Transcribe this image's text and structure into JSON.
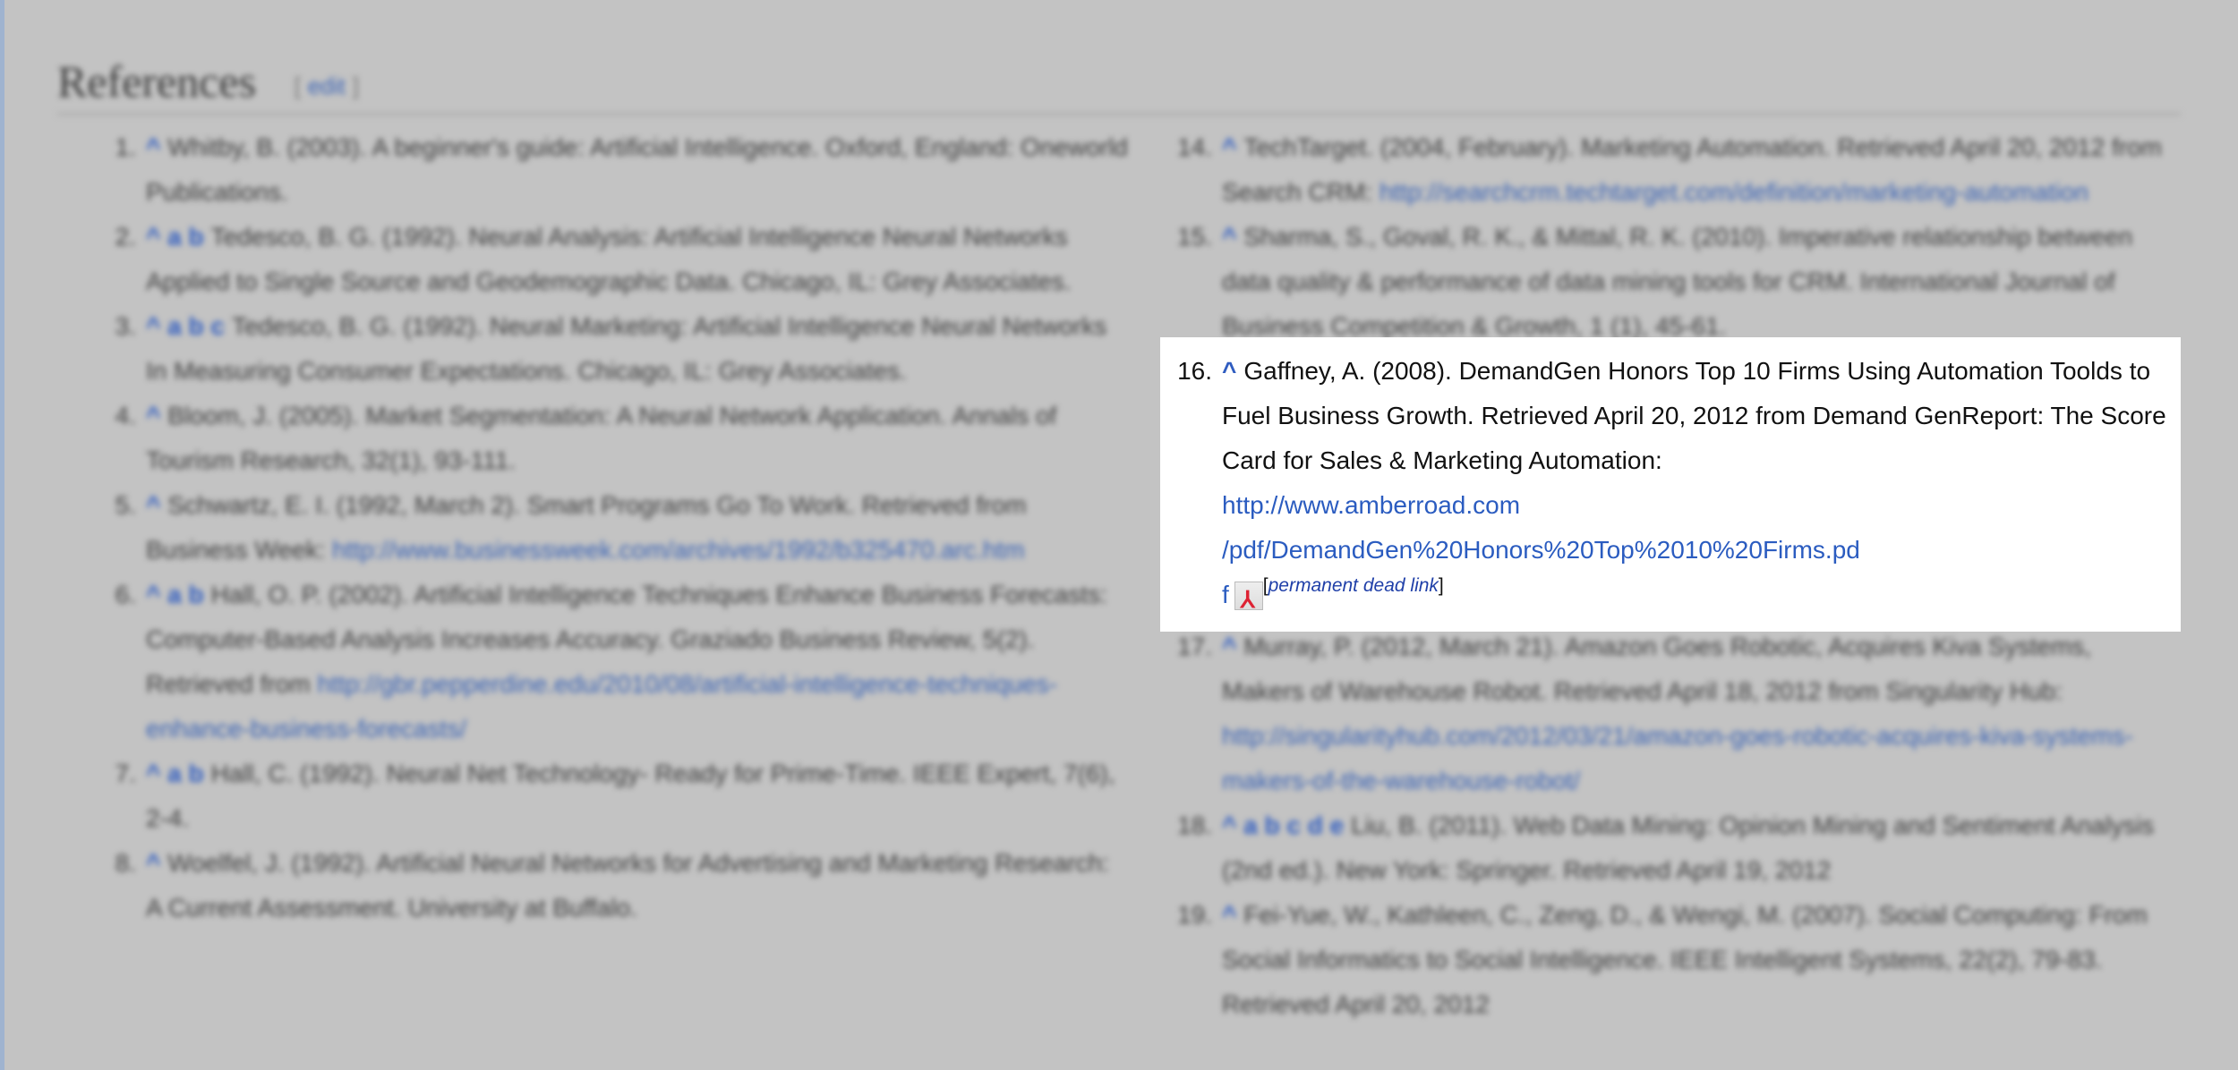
{
  "section": {
    "title": "References",
    "edit_label": "edit",
    "bracket_open": "[",
    "bracket_close": "]"
  },
  "colors": {
    "link": "#2b5cc0",
    "overlay": "#c3c3c3",
    "highlight_bg": "#ffffff"
  },
  "left_refs": [
    {
      "num": "1.",
      "caret": "^",
      "text": "Whitby, B. (2003). A beginner's guide: Artificial Intelligence. Oxford, England: Oneworld Publications.",
      "link": ""
    },
    {
      "num": "2.",
      "caret": "^ a b",
      "text": "Tedesco, B. G. (1992). Neural Analysis: Artificial Intelligence Neural Networks Applied to Single Source and Geodemographic Data. Chicago, IL: Grey Associates.",
      "link": ""
    },
    {
      "num": "3.",
      "caret": "^ a b c",
      "text": "Tedesco, B. G. (1992). Neural Marketing: Artificial Intelligence Neural Networks In Measuring Consumer Expectations. Chicago, IL: Grey Associates.",
      "link": ""
    },
    {
      "num": "4.",
      "caret": "^",
      "text": "Bloom, J. (2005). Market Segmentation: A Neural Network Application. Annals of Tourism Research, 32(1), 93-111.",
      "link": ""
    },
    {
      "num": "5.",
      "caret": "^",
      "text": "Schwartz, E. I. (1992, March 2). Smart Programs Go To Work. Retrieved from Business Week: ",
      "link": "http://www.businessweek.com/archives/1992/b325470.arc.htm"
    },
    {
      "num": "6.",
      "caret": "^ a b",
      "text": "Hall, O. P. (2002). Artificial Intelligence Techniques Enhance Business Forecasts: Computer-Based Analysis Increases Accuracy. Graziado Business Review, 5(2). Retrieved from ",
      "link": "http://gbr.pepperdine.edu/2010/08/artificial-intelligence-techniques-enhance-business-forecasts/"
    },
    {
      "num": "7.",
      "caret": "^ a b",
      "text": "Hall, C. (1992). Neural Net Technology- Ready for Prime-Time. IEEE Expert, 7(6), 2-4.",
      "link": ""
    },
    {
      "num": "8.",
      "caret": "^",
      "text": "Woelfel, J. (1992). Artificial Neural Networks for Advertising and Marketing Research: A Current Assessment. University at Buffalo.",
      "link": ""
    }
  ],
  "right_refs_before": [
    {
      "num": "14.",
      "caret": "^",
      "text": "TechTarget. (2004, February). Marketing Automation. Retrieved April 20, 2012 from Search CRM: ",
      "link": "http://searchcrm.techtarget.com/definition/marketing-automation"
    },
    {
      "num": "15.",
      "caret": "^",
      "text": "Sharma, S., Goval, R. K., & Mittal, R. K. (2010). Imperative relationship between data quality & performance of data mining tools for CRM. International Journal of Business Competition & Growth, 1 (1), 45-61.",
      "link": ""
    }
  ],
  "highlighted_ref": {
    "num": "16.",
    "caret": "^",
    "text": "Gaffney, A. (2008). DemandGen Honors Top 10 Firms Using Automation Toolds to Fuel Business Growth. Retrieved April 20, 2012 from Demand GenReport: The Score Card for Sales & Marketing Automation:",
    "link_line1": "http://www.amberroad.com",
    "link_line2": "/pdf/DemandGen%20Honors%20Top%2010%20Firms.pd",
    "link_line3": "f",
    "pdf_icon": "pdf-icon",
    "dead_link_label": "permanent dead link",
    "bracket_open": "[",
    "bracket_close": "]"
  },
  "right_refs_after": [
    {
      "num": "17.",
      "caret": "^",
      "text": "Murray, P. (2012, March 21). Amazon Goes Robotic, Acquires Kiva Systems, Makers of Warehouse Robot. Retrieved April 18, 2012 from Singularity Hub: ",
      "link": "http://singularityhub.com/2012/03/21/amazon-goes-robotic-acquires-kiva-systems-makers-of-the-warehouse-robot/"
    },
    {
      "num": "18.",
      "caret": "^ a b c d e",
      "text": "Liu, B. (2011). Web Data Mining: Opinion Mining and Sentiment Analysis (2nd ed.). New York: Springer. Retrieved April 19, 2012",
      "link": ""
    },
    {
      "num": "19.",
      "caret": "^",
      "text": "Fei-Yue, W., Kathleen, C., Zeng, D., & Wengi, M. (2007). Social Computing: From Social Informatics to Social Intelligence. IEEE Intelligent Systems, 22(2), 79-83. Retrieved April 20, 2012",
      "link": ""
    }
  ]
}
